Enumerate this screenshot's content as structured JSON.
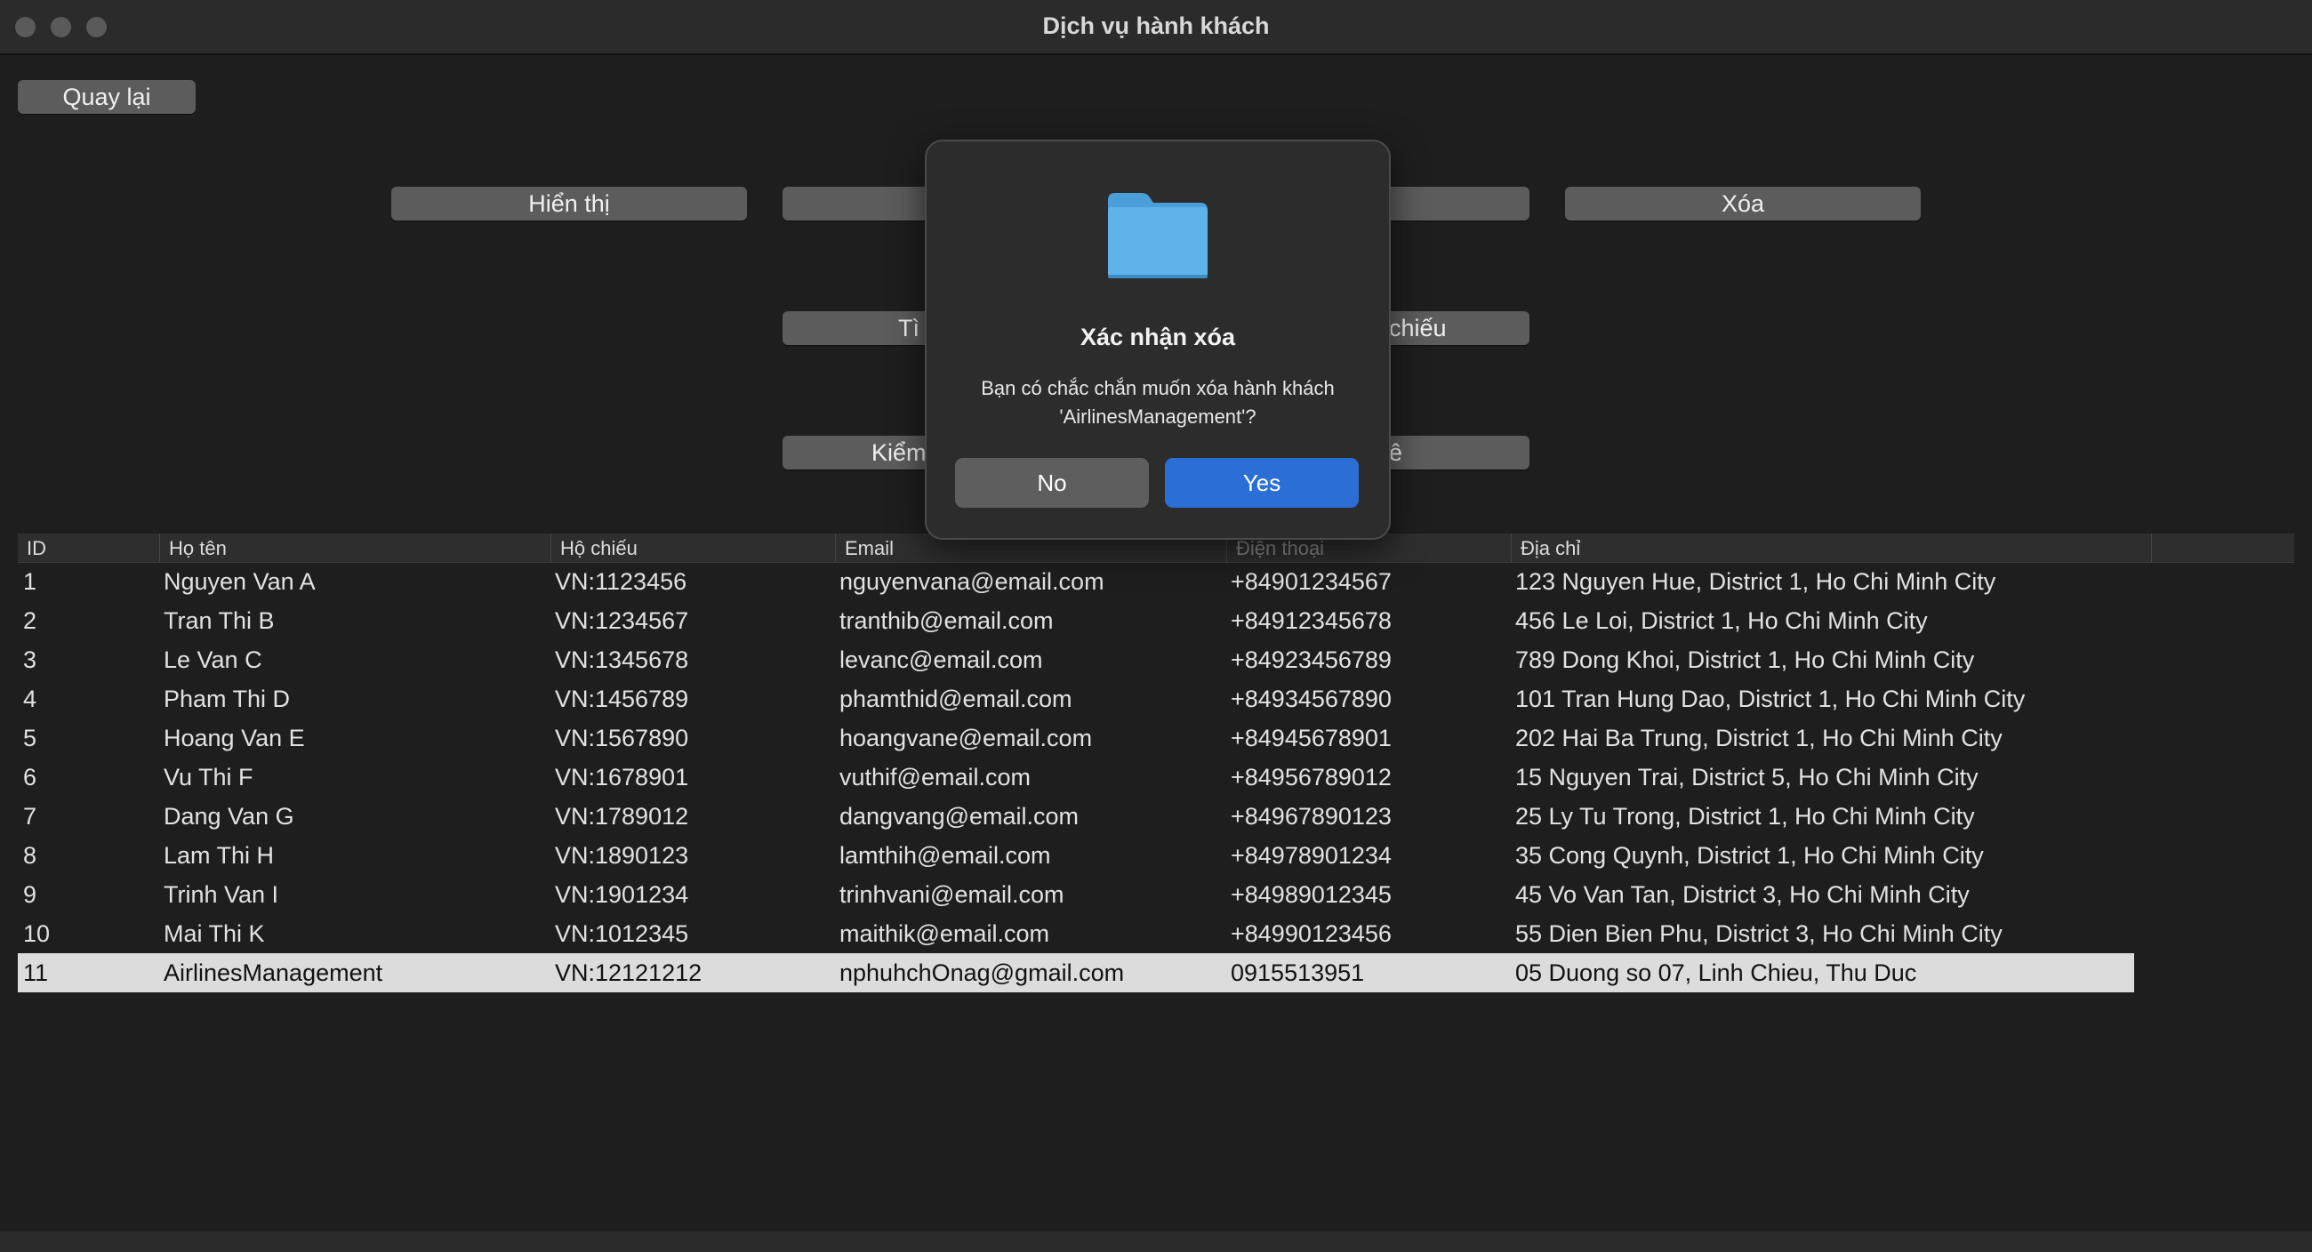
{
  "window": {
    "title": "Dịch vụ hành khách"
  },
  "toolbar": {
    "back_label": "Quay lại",
    "buttons": [
      {
        "label": "Hiển thị"
      },
      {
        "label": ""
      },
      {
        "label": ""
      },
      {
        "label": "Xóa"
      },
      {
        "label": "Tì"
      },
      {
        "label": "chiếu"
      },
      {
        "label": "Kiểm"
      },
      {
        "label": "ê"
      }
    ]
  },
  "table": {
    "columns": [
      "ID",
      "Họ tên",
      "Hộ chiếu",
      "Email",
      "Điện thoại",
      "Địa chỉ"
    ],
    "rows": [
      [
        "1",
        "Nguyen Van A",
        "VN:1123456",
        "nguyenvana@email.com",
        "+84901234567",
        "123 Nguyen Hue, District 1, Ho Chi Minh City"
      ],
      [
        "2",
        "Tran Thi B",
        "VN:1234567",
        "tranthib@email.com",
        "+84912345678",
        "456 Le Loi, District 1, Ho Chi Minh City"
      ],
      [
        "3",
        "Le Van C",
        "VN:1345678",
        "levanc@email.com",
        "+84923456789",
        "789 Dong Khoi, District 1, Ho Chi Minh City"
      ],
      [
        "4",
        "Pham Thi D",
        "VN:1456789",
        "phamthid@email.com",
        "+84934567890",
        "101 Tran Hung Dao, District 1, Ho Chi Minh City"
      ],
      [
        "5",
        "Hoang Van E",
        "VN:1567890",
        "hoangvane@email.com",
        "+84945678901",
        "202 Hai Ba Trung, District 1, Ho Chi Minh City"
      ],
      [
        "6",
        "Vu Thi F",
        "VN:1678901",
        "vuthif@email.com",
        "+84956789012",
        "15 Nguyen Trai, District 5, Ho Chi Minh City"
      ],
      [
        "7",
        "Dang Van G",
        "VN:1789012",
        "dangvang@email.com",
        "+84967890123",
        "25 Ly Tu Trong, District 1, Ho Chi Minh City"
      ],
      [
        "8",
        "Lam Thi H",
        "VN:1890123",
        "lamthih@email.com",
        "+84978901234",
        "35 Cong Quynh, District 1, Ho Chi Minh City"
      ],
      [
        "9",
        "Trinh Van I",
        "VN:1901234",
        "trinhvani@email.com",
        "+84989012345",
        "45 Vo Van Tan, District 3, Ho Chi Minh City"
      ],
      [
        "10",
        "Mai Thi K",
        "VN:1012345",
        "maithik@email.com",
        "+84990123456",
        "55 Dien Bien Phu, District 3, Ho Chi Minh City"
      ],
      [
        "11",
        "AirlinesManagement",
        "VN:12121212",
        "nphuhchOnag@gmail.com",
        "0915513951",
        "05 Duong so 07, Linh Chieu, Thu Duc"
      ]
    ],
    "selected_row": 10
  },
  "dialog": {
    "icon": "folder-icon",
    "title": "Xác nhận xóa",
    "message": "Bạn có chắc chắn muốn xóa hành khách 'AirlinesManagement'?",
    "no_label": "No",
    "yes_label": "Yes"
  },
  "colors": {
    "accent": "#2b6fd6",
    "background": "#1e1e1e",
    "selected_row": "#dcdcdc"
  }
}
